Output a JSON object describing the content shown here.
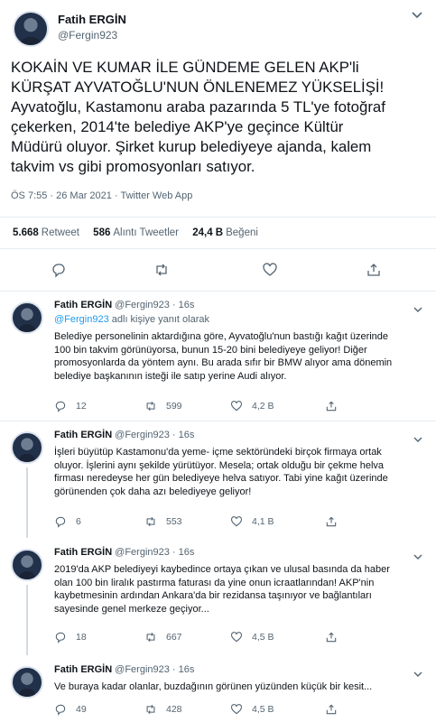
{
  "colors": {
    "accent": "#1d9bf0",
    "muted": "#536471",
    "text": "#0f1419",
    "border": "#e6ecf0"
  },
  "main_tweet": {
    "name": "Fatih ERGİN",
    "handle": "@Fergin923",
    "text": "KOKAİN VE KUMAR İLE GÜNDEME GELEN AKP'li\nKÜRŞAT AYVATOĞLU'NUN ÖNLENEMEZ YÜKSELİŞİ!\nAyvatoğlu, Kastamonu araba pazarında 5 TL'ye fotoğraf\nçekerken, 2014'te belediye AKP'ye geçince Kültür\nMüdürü oluyor. Şirket kurup belediyeye ajanda, kalem\ntakvim vs gibi promosyonları satıyor.",
    "meta": "ÖS 7:55 · 26 Mar 2021 · Twitter Web App",
    "retweets_count": "5.668",
    "retweets_label": "Retweet",
    "quotes_count": "586",
    "quotes_label": "Alıntı Tweetler",
    "likes_count": "24,4 B",
    "likes_label": "Beğeni",
    "action_icons": [
      "reply-icon",
      "retweet-icon",
      "like-icon",
      "share-icon"
    ]
  },
  "replies": [
    {
      "name": "Fatih ERGİN",
      "handle": "@Fergin923 · 16s",
      "replying_mention": "@Fergin923",
      "replying_suffix": "adlı kişiye yanıt olarak",
      "text": "Belediye personelinin aktardığına göre, Ayvatoğlu'nun bastığı kağıt üzerinde\n100 bin takvim görünüyorsa, bunun 15-20 bini belediyeye geliyor! Diğer\npromosyonlarda da yöntem aynı. Bu arada sıfır bir BMW alıyor ama dönemin\nbelediye başkanının isteği ile satıp yerine Audi alıyor.",
      "replies": "12",
      "retweets": "599",
      "likes": "4,2 B"
    },
    {
      "name": "Fatih ERGİN",
      "handle": "@Fergin923 · 16s",
      "text": "İşleri büyütüp Kastamonu'da yeme- içme sektöründeki birçok firmaya ortak\noluyor. İşlerini aynı şekilde yürütüyor. Mesela; ortak olduğu bir çekme helva\nfirması neredeyse her gün belediyeye helva satıyor. Tabi yine kağıt üzerinde\ngörünenden çok daha azı belediyeye geliyor!",
      "replies": "6",
      "retweets": "553",
      "likes": "4,1 B"
    },
    {
      "name": "Fatih ERGİN",
      "handle": "@Fergin923 · 16s",
      "text": "2019'da AKP belediyeyi kaybedince ortaya çıkan ve ulusal basında da haber\nolan 100 bin liralık pastırma faturası da yine onun icraatlarından! AKP'nin\nkaybetmesinin ardından Ankara'da bir rezidansa taşınıyor ve bağlantıları\nsayesinde genel merkeze geçiyor...",
      "replies": "18",
      "retweets": "667",
      "likes": "4,5 B"
    },
    {
      "name": "Fatih ERGİN",
      "handle": "@Fergin923 · 16s",
      "text": "Ve buraya kadar olanlar, buzdağının görünen yüzünden küçük bir kesit...",
      "replies": "49",
      "retweets": "428",
      "likes": "4,5 B"
    }
  ]
}
